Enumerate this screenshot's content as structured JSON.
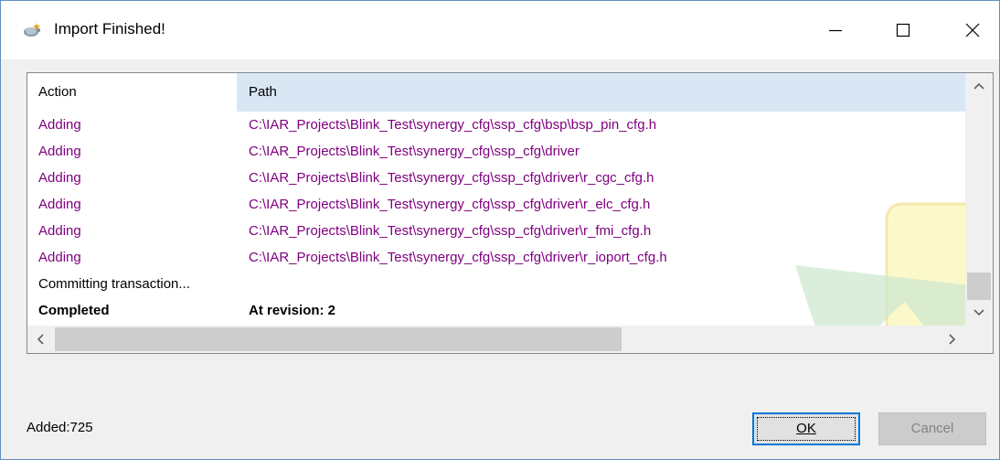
{
  "window": {
    "title": "Import Finished!",
    "app_icon": "tortoise-svn-icon",
    "controls": [
      "minimize-icon",
      "maximize-icon",
      "close-icon"
    ]
  },
  "list": {
    "columns": [
      "Action",
      "Path"
    ],
    "rows": [
      {
        "action": "Adding",
        "path": "C:\\IAR_Projects\\Blink_Test\\synergy_cfg\\ssp_cfg\\bsp\\bsp_pin_cfg.h",
        "style": "added"
      },
      {
        "action": "Adding",
        "path": "C:\\IAR_Projects\\Blink_Test\\synergy_cfg\\ssp_cfg\\driver",
        "style": "added"
      },
      {
        "action": "Adding",
        "path": "C:\\IAR_Projects\\Blink_Test\\synergy_cfg\\ssp_cfg\\driver\\r_cgc_cfg.h",
        "style": "added"
      },
      {
        "action": "Adding",
        "path": "C:\\IAR_Projects\\Blink_Test\\synergy_cfg\\ssp_cfg\\driver\\r_elc_cfg.h",
        "style": "added"
      },
      {
        "action": "Adding",
        "path": "C:\\IAR_Projects\\Blink_Test\\synergy_cfg\\ssp_cfg\\driver\\r_fmi_cfg.h",
        "style": "added"
      },
      {
        "action": "Adding",
        "path": "C:\\IAR_Projects\\Blink_Test\\synergy_cfg\\ssp_cfg\\driver\\r_ioport_cfg.h",
        "style": "added"
      },
      {
        "action": "Committing transaction...",
        "path": "",
        "style": "normal"
      },
      {
        "action": "Completed",
        "path": "At revision: 2",
        "style": "bold"
      }
    ],
    "colors": {
      "added": "#800080",
      "header_selected": "#d9e7f5"
    }
  },
  "status": {
    "text": "Added:725"
  },
  "buttons": {
    "ok": "OK",
    "cancel": "Cancel"
  }
}
